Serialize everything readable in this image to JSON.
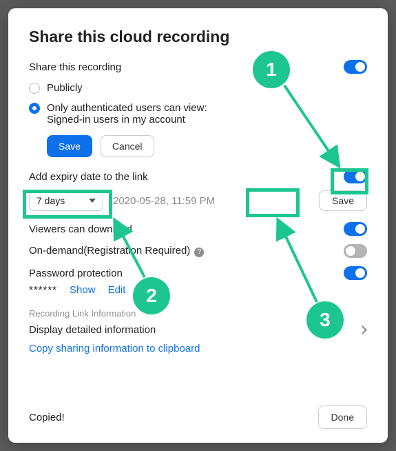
{
  "title": "Share this cloud recording",
  "share_heading": "Share this recording",
  "radios": {
    "public": "Publicly",
    "auth_line1": "Only authenticated users can view:",
    "auth_line2": "Signed-in users in my account"
  },
  "buttons": {
    "save": "Save",
    "cancel": "Cancel",
    "expiry_save": "Save",
    "done": "Done"
  },
  "expiry": {
    "label": "Add expiry date to the link",
    "select_value": "7 days",
    "timestamp": "2020-05-28, 11:59 PM"
  },
  "rows": {
    "download": "Viewers can download",
    "ondemand": "On-demand(Registration Required)",
    "password": "Password protection"
  },
  "password": {
    "mask": "******",
    "show": "Show",
    "edit": "Edit"
  },
  "rec_info_heading": "Recording Link Information",
  "display_detailed": "Display detailed information",
  "copy_clipboard": "Copy sharing information to clipboard",
  "copied": "Copied!",
  "callouts": {
    "one": "1",
    "two": "2",
    "three": "3"
  },
  "help_glyph": "?"
}
